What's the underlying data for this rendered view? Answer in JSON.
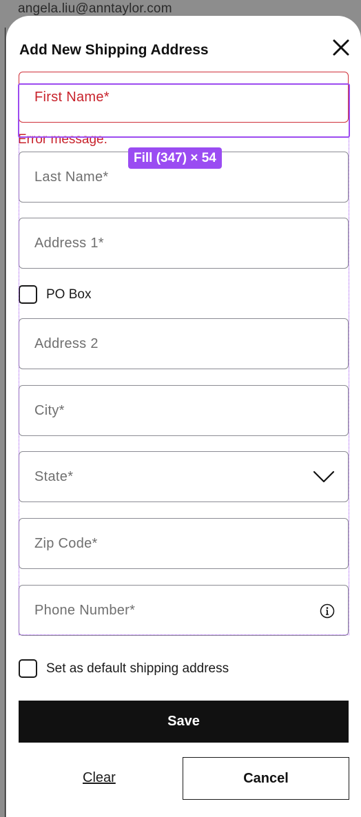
{
  "background": {
    "email": "angela.liu@anntaylor.com"
  },
  "dialog": {
    "title": "Add New Shipping Address",
    "close_icon": "close-icon"
  },
  "form": {
    "first_name": {
      "placeholder": "First Name*",
      "error": "Error message.",
      "state": "error"
    },
    "last_name": {
      "placeholder": "Last Name*"
    },
    "address1": {
      "placeholder": "Address 1*"
    },
    "po_box": {
      "label": "PO Box",
      "checked": false
    },
    "address2": {
      "placeholder": "Address 2"
    },
    "city": {
      "placeholder": "City*"
    },
    "state": {
      "placeholder": "State*",
      "icon": "chevron-down-icon"
    },
    "zip": {
      "placeholder": "Zip Code*"
    },
    "phone": {
      "placeholder": "Phone Number*",
      "icon": "info-icon"
    },
    "default_address": {
      "label": "Set as default shipping address",
      "checked": false
    }
  },
  "actions": {
    "save": "Save",
    "clear": "Clear",
    "cancel": "Cancel"
  },
  "design_overlay": {
    "fill_label": "Fill (347) × 54"
  },
  "colors": {
    "error": "#c8232c",
    "selection": "#9c4bf0",
    "primary_button": "#111111"
  }
}
